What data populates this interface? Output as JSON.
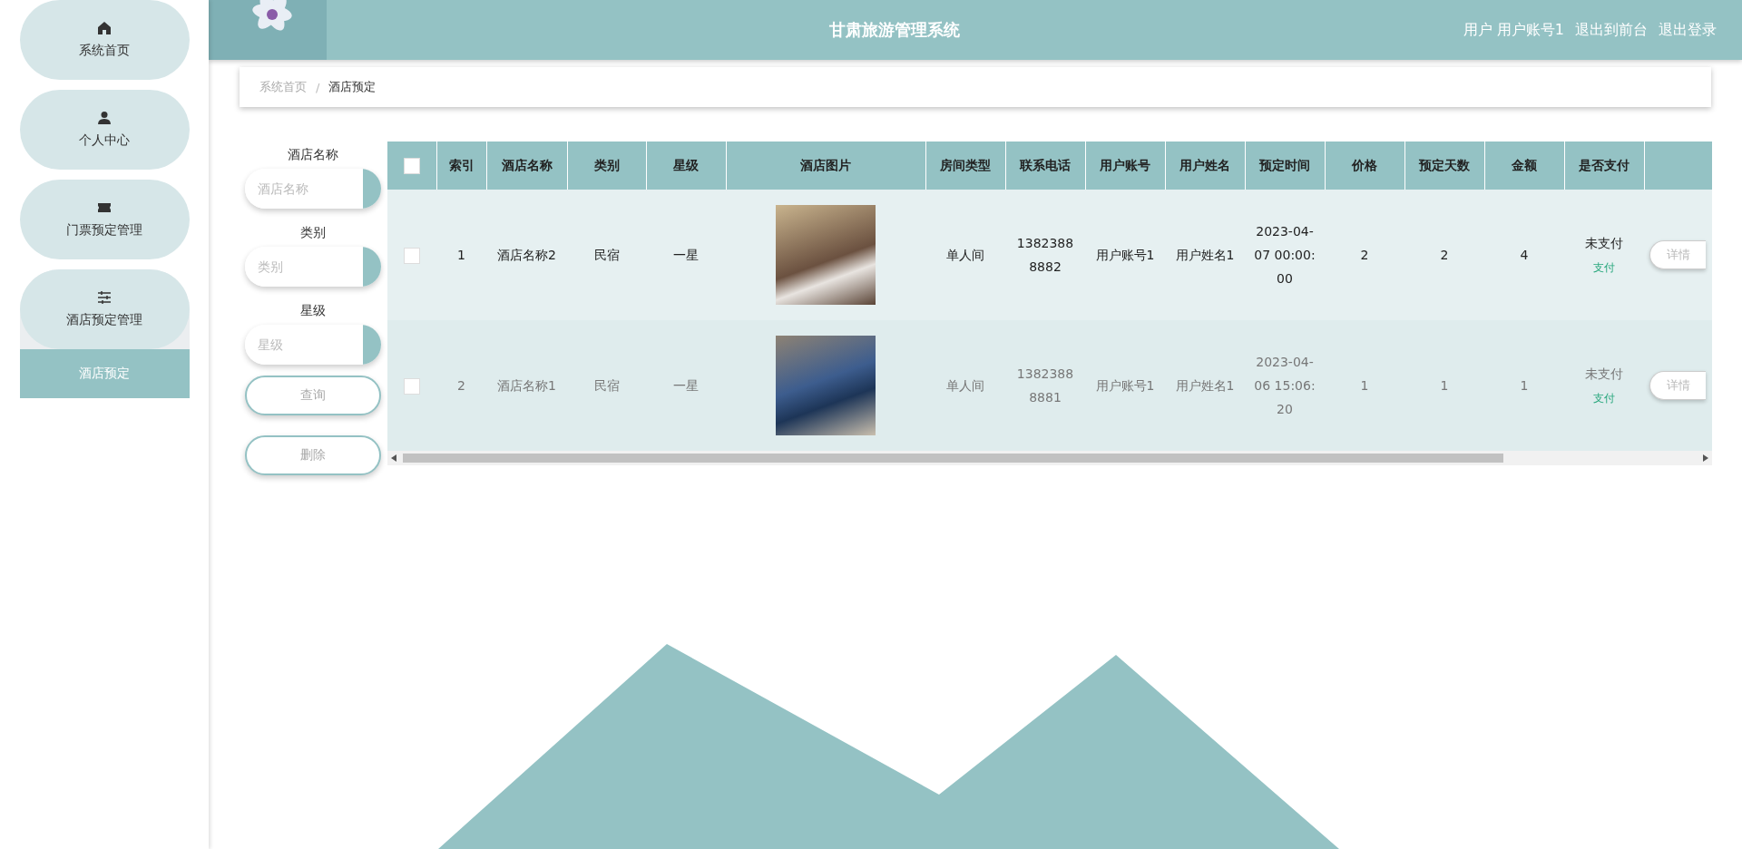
{
  "sidebar": {
    "items": [
      {
        "label": "系统首页",
        "expanded": false
      },
      {
        "label": "个人中心",
        "expanded": false
      },
      {
        "label": "门票预定管理",
        "expanded": false
      },
      {
        "label": "酒店预定管理",
        "expanded": true,
        "children": [
          {
            "label": "酒店预定",
            "selected": true
          }
        ]
      }
    ]
  },
  "header": {
    "title": "甘肃旅游管理系统",
    "user": "用户 用户账号1",
    "links": [
      "退出到前台",
      "退出登录"
    ]
  },
  "breadcrumb": {
    "items": [
      "系统首页",
      "酒店预定"
    ],
    "separator": "/"
  },
  "search": {
    "fields": [
      {
        "label": "酒店名称",
        "placeholder": "酒店名称"
      },
      {
        "label": "类别",
        "placeholder": "类别"
      },
      {
        "label": "星级",
        "placeholder": "星级"
      }
    ],
    "buttons": [
      "查询",
      "删除"
    ]
  },
  "table": {
    "select_all": {
      "checked": false
    },
    "columns": [
      "索引",
      "酒店名称",
      "类别",
      "星级",
      "酒店图片",
      "房间类型",
      "联系电话",
      "用户账号",
      "用户姓名",
      "预定时间",
      "价格",
      "预定天数",
      "金额",
      "是否支付"
    ],
    "rows": [
      {
        "highlighted": true,
        "checked": false,
        "cells": [
          "1",
          "酒店名称2",
          "民宿",
          "一星",
          null,
          "单人间",
          "13823888882",
          "用户账号1",
          "用户姓名1",
          "2023-04-07 00:00:00",
          "2",
          "2",
          "4"
        ],
        "pay_status": "未支付",
        "pay_link": "支付",
        "detail_button": "详情"
      },
      {
        "highlighted": false,
        "checked": false,
        "cells": [
          "2",
          "酒店名称1",
          "民宿",
          "一星",
          null,
          "单人间",
          "13823888881",
          "用户账号1",
          "用户姓名1",
          "2023-04-06 15:06:20",
          "1",
          "1",
          "1"
        ],
        "pay_status": "未支付",
        "pay_link": "支付",
        "detail_button": "详情"
      }
    ]
  }
}
